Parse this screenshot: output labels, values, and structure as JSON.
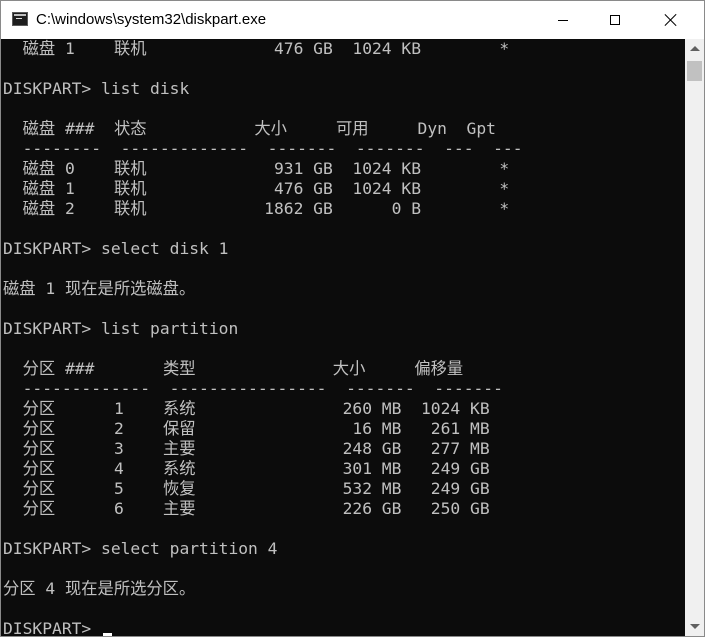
{
  "window": {
    "title": "C:\\windows\\system32\\diskpart.exe",
    "icon": "console-icon",
    "controls": [
      "minimize-icon",
      "maximize-icon",
      "close-icon"
    ]
  },
  "console": {
    "lines": [
      "  磁盘 1    联机             476 GB  1024 KB        *",
      "",
      "DISKPART> list disk",
      "",
      "  磁盘 ###  状态           大小     可用     Dyn  Gpt",
      "  --------  -------------  -------  -------  ---  ---",
      "  磁盘 0    联机             931 GB  1024 KB        *",
      "  磁盘 1    联机             476 GB  1024 KB        *",
      "  磁盘 2    联机            1862 GB      0 B        *",
      "",
      "DISKPART> select disk 1",
      "",
      "磁盘 1 现在是所选磁盘。",
      "",
      "DISKPART> list partition",
      "",
      "  分区 ###       类型              大小     偏移量",
      "  -------------  ----------------  -------  -------",
      "  分区      1    系统               260 MB  1024 KB",
      "  分区      2    保留                16 MB   261 MB",
      "  分区      3    主要               248 GB   277 MB",
      "  分区      4    系统               301 MB   249 GB",
      "  分区      5    恢复               532 MB   249 GB",
      "  分区      6    主要               226 GB   250 GB",
      "",
      "DISKPART> select partition 4",
      "",
      "分区 4 现在是所选分区。",
      "",
      "DISKPART> "
    ]
  },
  "colors": {
    "console_background": "#0c0c0c",
    "console_text": "#c0c0c0",
    "titlebar": "#ffffff"
  }
}
